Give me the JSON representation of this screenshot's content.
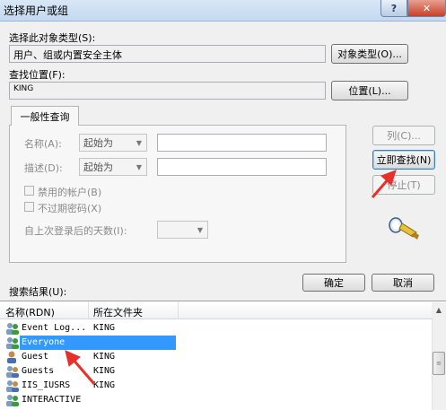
{
  "window": {
    "title": "选择用户或组",
    "help_glyph": "?",
    "close_glyph": "✕"
  },
  "object_type": {
    "label": "选择此对象类型(S):",
    "value": "用户、组或内置安全主体",
    "button": "对象类型(O)..."
  },
  "location": {
    "label": "查找位置(F):",
    "value": "KING",
    "button": "位置(L)..."
  },
  "query": {
    "tab_label": "一般性查询",
    "name_label": "名称(A):",
    "name_op": "起始为",
    "desc_label": "描述(D):",
    "desc_op": "起始为",
    "disabled_accounts": "禁用的帐户(B)",
    "non_expiring_pw": "不过期密码(X)",
    "days_since_logon": "自上次登录后的天数(I):"
  },
  "actions": {
    "columns_button": "列(C)...",
    "find_now_button": "立即查找(N)",
    "stop_button": "停止(T)",
    "ok_button": "确定",
    "cancel_button": "取消"
  },
  "results": {
    "label": "搜索结果(U):",
    "columns": [
      "名称(RDN)",
      "所在文件夹"
    ],
    "rows": [
      {
        "name": "Event Log...",
        "folder": "KING"
      },
      {
        "name": "Everyone",
        "folder": ""
      },
      {
        "name": "Guest",
        "folder": "KING"
      },
      {
        "name": "Guests",
        "folder": "KING"
      },
      {
        "name": "IIS_IUSRS",
        "folder": "KING"
      },
      {
        "name": "INTERACTIVE",
        "folder": ""
      }
    ],
    "selected_index": 1
  },
  "colors": {
    "selection": "#3399ff",
    "annotation_arrow": "#e8302a"
  },
  "icons": [
    "question-icon",
    "close-icon",
    "chevron-down-icon",
    "search-flashlight-icon",
    "user-group-icon",
    "annotation-arrow"
  ]
}
